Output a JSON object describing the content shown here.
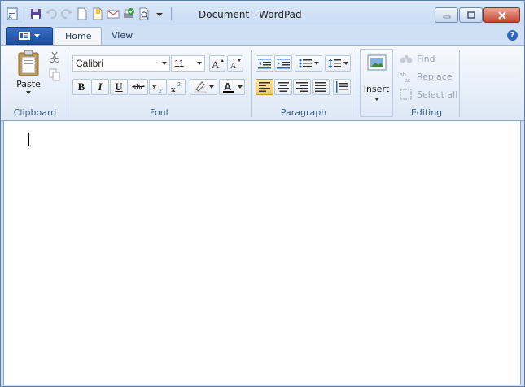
{
  "window": {
    "title": "Document - WordPad"
  },
  "tabs": {
    "home": "Home",
    "view": "View"
  },
  "font": {
    "family": "Calibri",
    "size": "11"
  },
  "groups": {
    "clipboard": "Clipboard",
    "font": "Font",
    "paragraph": "Paragraph",
    "editing": "Editing"
  },
  "clipboard": {
    "paste": "Paste"
  },
  "insert": {
    "label": "Insert"
  },
  "editing": {
    "find": "Find",
    "replace": "Replace",
    "select_all": "Select all"
  },
  "format": {
    "bold": "B",
    "italic": "I",
    "underline": "U",
    "strike": "abc"
  },
  "colors": {
    "accent": "#2f66be",
    "font_color_bar": "#000000",
    "highlight_bar": "#ffffff"
  }
}
